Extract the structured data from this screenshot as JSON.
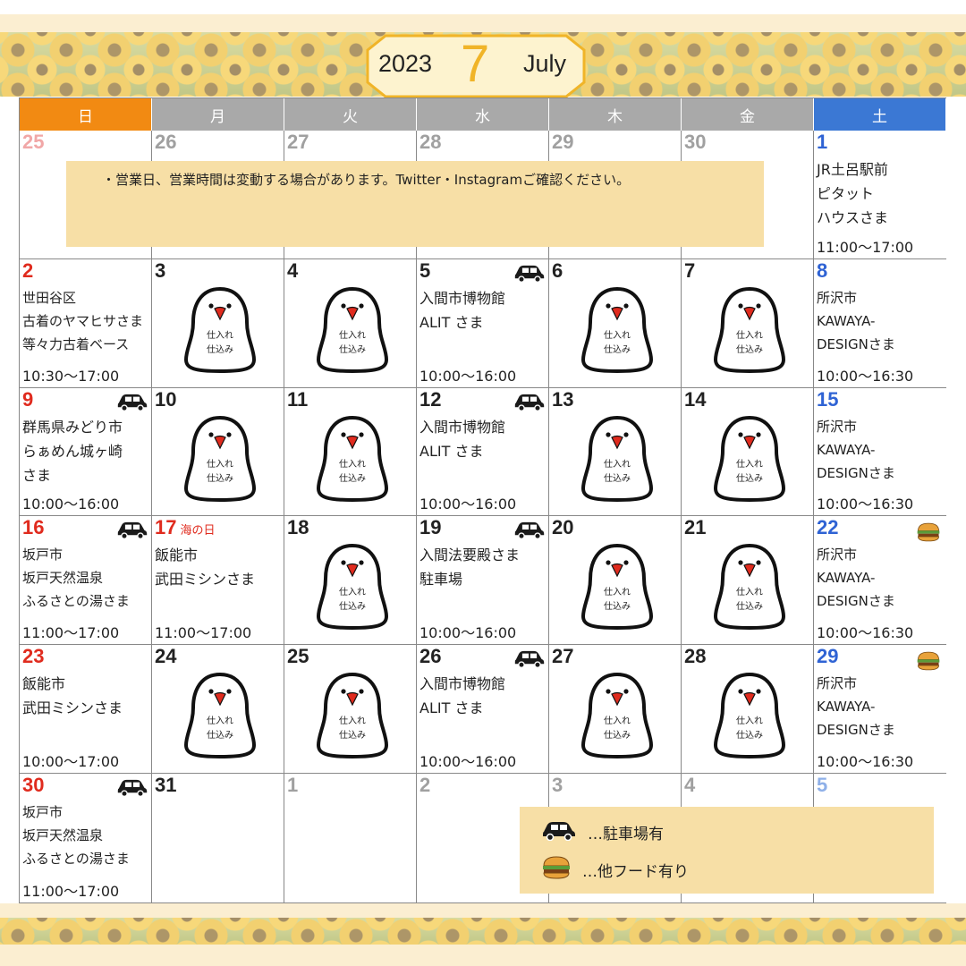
{
  "header": {
    "year": "2023",
    "month_number": "7",
    "month_name": "July"
  },
  "weekdays": [
    "日",
    "月",
    "火",
    "水",
    "木",
    "金",
    "土"
  ],
  "colors": {
    "sunday_header": "#f28a12",
    "saturday_header": "#3b78d4",
    "weekday_header": "#a9a9a9",
    "notice_bg": "#f7dfa6",
    "month_number": "#f0b428"
  },
  "notice": "・営業日、営業時間は変動する場合があります。Twitter・Instagramご確認ください。",
  "bird": {
    "line1": "仕入れ",
    "line2": "仕込み"
  },
  "weeks": [
    [
      {
        "day": "25",
        "style": "pink"
      },
      {
        "day": "26",
        "style": "grey"
      },
      {
        "day": "27",
        "style": "grey"
      },
      {
        "day": "28",
        "style": "grey"
      },
      {
        "day": "29",
        "style": "grey"
      },
      {
        "day": "30",
        "style": "grey"
      },
      {
        "day": "1",
        "style": "blue",
        "venue": [
          "JR土呂駅前",
          "ピタット",
          "ハウスさま"
        ],
        "time": "11:00〜17:00"
      }
    ],
    [
      {
        "day": "2",
        "style": "red",
        "venue": [
          "世田谷区",
          "古着のヤマヒサさま",
          "等々力古着ベース"
        ],
        "time": "10:30〜17:00"
      },
      {
        "day": "3",
        "bird": true
      },
      {
        "day": "4",
        "bird": true
      },
      {
        "day": "5",
        "venue": [
          "入間市博物館",
          "ALIT さま"
        ],
        "time": "10:00〜16:00",
        "icon": "car-icon"
      },
      {
        "day": "6",
        "bird": true
      },
      {
        "day": "7",
        "bird": true
      },
      {
        "day": "8",
        "style": "blue",
        "venue": [
          "所沢市",
          "KAWAYA-",
          "DESIGNさま"
        ],
        "time": "10:00〜16:30"
      }
    ],
    [
      {
        "day": "9",
        "style": "red",
        "venue": [
          "群馬県みどり市",
          "らぁめん城ヶ崎",
          "さま"
        ],
        "time": "10:00〜16:00",
        "icon": "car-icon"
      },
      {
        "day": "10",
        "bird": true
      },
      {
        "day": "11",
        "bird": true
      },
      {
        "day": "12",
        "venue": [
          "入間市博物館",
          "ALIT さま"
        ],
        "time": "10:00〜16:00",
        "icon": "car-icon"
      },
      {
        "day": "13",
        "bird": true
      },
      {
        "day": "14",
        "bird": true
      },
      {
        "day": "15",
        "style": "blue",
        "venue": [
          "所沢市",
          "KAWAYA-",
          "DESIGNさま"
        ],
        "time": "10:00〜16:30"
      }
    ],
    [
      {
        "day": "16",
        "style": "red",
        "venue": [
          "坂戸市",
          "坂戸天然温泉",
          "ふるさとの湯さま"
        ],
        "time": "11:00〜17:00",
        "icon": "car-icon"
      },
      {
        "day": "17",
        "style": "red",
        "holiday": "海の日",
        "venue": [
          "飯能市",
          "武田ミシンさま"
        ],
        "time": "11:00〜17:00"
      },
      {
        "day": "18",
        "bird": true
      },
      {
        "day": "19",
        "venue": [
          "入間法要殿さま",
          "駐車場"
        ],
        "time": "10:00〜16:00",
        "icon": "car-icon"
      },
      {
        "day": "20",
        "bird": true
      },
      {
        "day": "21",
        "bird": true
      },
      {
        "day": "22",
        "style": "blue",
        "venue": [
          "所沢市",
          "KAWAYA-",
          "DESIGNさま"
        ],
        "time": "10:00〜16:30",
        "icon": "burger-icon"
      }
    ],
    [
      {
        "day": "23",
        "style": "red",
        "venue": [
          "飯能市",
          "武田ミシンさま"
        ],
        "time": "10:00〜17:00"
      },
      {
        "day": "24",
        "bird": true
      },
      {
        "day": "25",
        "bird": true
      },
      {
        "day": "26",
        "venue": [
          "入間市博物館",
          "ALIT さま"
        ],
        "time": "10:00〜16:00",
        "icon": "car-icon"
      },
      {
        "day": "27",
        "bird": true
      },
      {
        "day": "28",
        "bird": true
      },
      {
        "day": "29",
        "style": "blue",
        "venue": [
          "所沢市",
          "KAWAYA-",
          "DESIGNさま"
        ],
        "time": "10:00〜16:30",
        "icon": "burger-icon"
      }
    ],
    [
      {
        "day": "30",
        "style": "red",
        "venue": [
          "坂戸市",
          "坂戸天然温泉",
          "ふるさとの湯さま"
        ],
        "time": "11:00〜17:00",
        "icon": "car-icon"
      },
      {
        "day": "31"
      },
      {
        "day": "1",
        "style": "grey"
      },
      {
        "day": "2",
        "style": "grey"
      },
      {
        "day": "3",
        "style": "grey"
      },
      {
        "day": "4",
        "style": "grey"
      },
      {
        "day": "5",
        "style": "lblue"
      }
    ]
  ],
  "legend": [
    {
      "icon": "car-icon",
      "text": "…駐車場有"
    },
    {
      "icon": "burger-icon",
      "text": "…他フード有り"
    }
  ]
}
